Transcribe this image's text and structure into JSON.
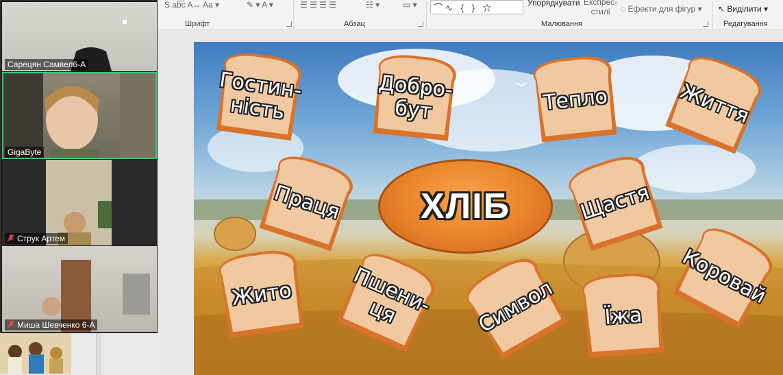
{
  "ribbon": {
    "groups": [
      {
        "label": "Шрифт"
      },
      {
        "label": "Абзац"
      },
      {
        "label": "Малювання"
      },
      {
        "label": "Редагування"
      }
    ],
    "arrange_label": "Упорядкувати",
    "quick_styles_label": "Експрес-\nстилі",
    "shape_effects_label": "Ефекти для фігур",
    "select_label": "Виділити",
    "shapes_preview": "⌒∿ { } ☆"
  },
  "slide": {
    "center_word": "ХЛІБ",
    "breads": [
      {
        "text": "Гостин-\nність"
      },
      {
        "text": "Добро-\nбут"
      },
      {
        "text": "Тепло"
      },
      {
        "text": "Життя"
      },
      {
        "text": "Праця"
      },
      {
        "text": "Щастя"
      },
      {
        "text": "Коровай"
      },
      {
        "text": "Жито"
      },
      {
        "text": "Пшени-\nця"
      },
      {
        "text": "Символ"
      },
      {
        "text": "Їжа"
      }
    ]
  },
  "gallery": {
    "participants": [
      {
        "name": "Сарецян Самвел6-А",
        "muted": false
      },
      {
        "name": "GigaByte",
        "muted": false
      },
      {
        "name": "Струк Артем",
        "muted": true
      },
      {
        "name": "Миша Шевченко 6-А",
        "muted": true
      }
    ]
  },
  "colors": {
    "active_speaker": "#2ecc71",
    "bread_crust": "#d9732c",
    "bread_inside": "#f1c9a1",
    "center_oval": "#e9822a",
    "muted_mic": "#e04b4b"
  }
}
